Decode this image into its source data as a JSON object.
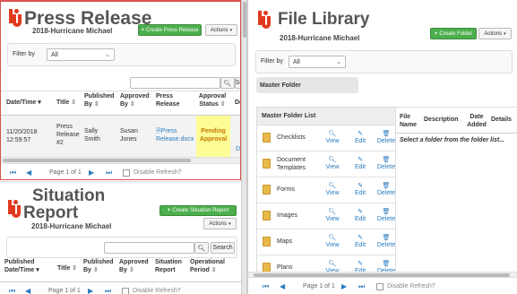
{
  "press": {
    "title": "Press Release",
    "subtitle": "2018-Hurricane Michael",
    "create_btn": "Create Press Release",
    "actions_btn": "Actions",
    "filter_label": "Filter by",
    "filter_value": "All",
    "search_btn": "Se",
    "columns": [
      {
        "label": "Date/Time",
        "sort": "▾"
      },
      {
        "label": "Title",
        "sort": "⇕"
      },
      {
        "label": "Published By",
        "sort": "⇕"
      },
      {
        "label": "Approved By",
        "sort": "⇕"
      },
      {
        "label": "Press Release",
        "sort": ""
      },
      {
        "label": "Approval Status",
        "sort": "⇕"
      },
      {
        "label": "De",
        "sort": ""
      }
    ],
    "row": {
      "datetime": "11/20/2018 12:59:57",
      "title": "Press Release #2",
      "published_by": "Sally Smith",
      "approved_by": "Susan Jones",
      "file": "Press Release.docx",
      "status": "Pending Approval",
      "extra": "D"
    },
    "pager": {
      "text": "Page 1 of 1",
      "refresh": "Disable Refresh?"
    }
  },
  "situation": {
    "title_line1": "Situation",
    "title_line2": "Report",
    "subtitle": "2018-Hurricane Michael",
    "create_btn": "Create Situation Report",
    "actions_btn": "Actions",
    "search_btn": "Search",
    "columns": [
      {
        "label": "Published Date/Time",
        "sort": "▾"
      },
      {
        "label": "Title",
        "sort": "⇕"
      },
      {
        "label": "Published By",
        "sort": "⇕"
      },
      {
        "label": "Approved By",
        "sort": "⇕"
      },
      {
        "label": "Situation Report",
        "sort": ""
      },
      {
        "label": "Operational Period",
        "sort": "⇕"
      }
    ],
    "pager": {
      "text": "Page 1 of 1",
      "refresh": "Disable Refresh?"
    }
  },
  "library": {
    "title": "File Library",
    "subtitle": "2018-Hurricane Michael",
    "create_btn": "Create Folder",
    "actions_btn": "Actions",
    "filter_label": "Filter by",
    "filter_value": "All",
    "master_folder": "Master Folder",
    "folder_list_title": "Master Folder List",
    "folders": [
      {
        "name": "Checklists"
      },
      {
        "name": "Document Templates"
      },
      {
        "name": "Forms"
      },
      {
        "name": "Images"
      },
      {
        "name": "Maps"
      },
      {
        "name": "Plans"
      }
    ],
    "actions": {
      "view": "View",
      "edit": "Edit",
      "delete": "Delete"
    },
    "file_columns": [
      "File Name",
      "Description",
      "Date Added",
      "Details"
    ],
    "empty_msg": "Select a folder from the folder list...",
    "pager": {
      "text": "Page 1 of 1",
      "refresh": "Disable Refresh?"
    }
  },
  "colors": {
    "accent_red": "#e03a1e",
    "green": "#4cae4c",
    "link_blue": "#2a7abf",
    "pending_yellow": "#fdfd96"
  }
}
